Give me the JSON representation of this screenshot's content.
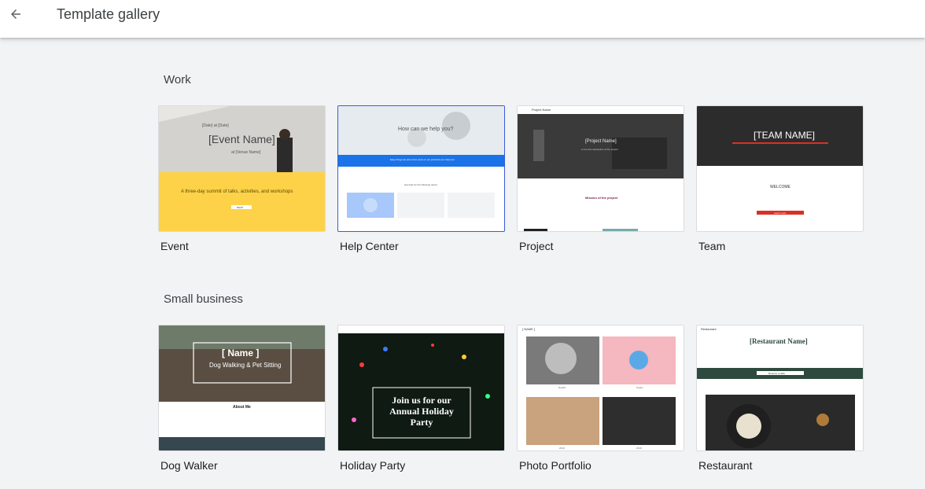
{
  "header": {
    "title": "Template gallery",
    "back_icon": "arrow-back-icon"
  },
  "sections": [
    {
      "title": "Work",
      "templates": [
        {
          "label": "Event",
          "thumb_title": "[Event Name]",
          "thumb_line": "[Date] at [Date]",
          "thumb_sub": "at [Venue Name]",
          "thumb_tagline": "A three-day summit of talks, activities, and workshops",
          "thumb_button": "RSVP",
          "accent": "#fcd34d"
        },
        {
          "label": "Help Center",
          "thumb_title": "How can we help you?",
          "thumb_banner": "Easy things we and a few more on our products at a help tool",
          "thumb_sub": "Get help for the following topics",
          "accent": "#1a73e8"
        },
        {
          "label": "Project",
          "thumb_logo": "Project Name",
          "thumb_title": "[Project Name]",
          "thumb_sub": "A one-line description of the project",
          "thumb_heading": "Mission of the project",
          "accent": "#7a1a4a"
        },
        {
          "label": "Team",
          "thumb_title": "[TEAM NAME]",
          "thumb_heading": "WELCOME",
          "thumb_button": "Learn more",
          "accent": "#d93025"
        }
      ]
    },
    {
      "title": "Small business",
      "templates": [
        {
          "label": "Dog Walker",
          "thumb_title": "[ Name ]",
          "thumb_sub": "Dog Walking & Pet Sitting",
          "thumb_heading": "About Me",
          "accent": "#37474f"
        },
        {
          "label": "Holiday Party",
          "thumb_title": "Join us for our Annual Holiday Party",
          "accent": "#ffffff"
        },
        {
          "label": "Photo Portfolio",
          "thumb_logo": "[ NAME ]",
          "thumb_caption_1": "Details",
          "thumb_caption_2": "Studio",
          "thumb_caption_3": "2019",
          "thumb_caption_4": "2019",
          "accent": "#f5b7c0"
        },
        {
          "label": "Restaurant",
          "thumb_logo": "Restaurant",
          "thumb_title": "[Restaurant Name]",
          "thumb_button": "Reserve a table",
          "accent": "#2e4a3f"
        }
      ]
    }
  ]
}
